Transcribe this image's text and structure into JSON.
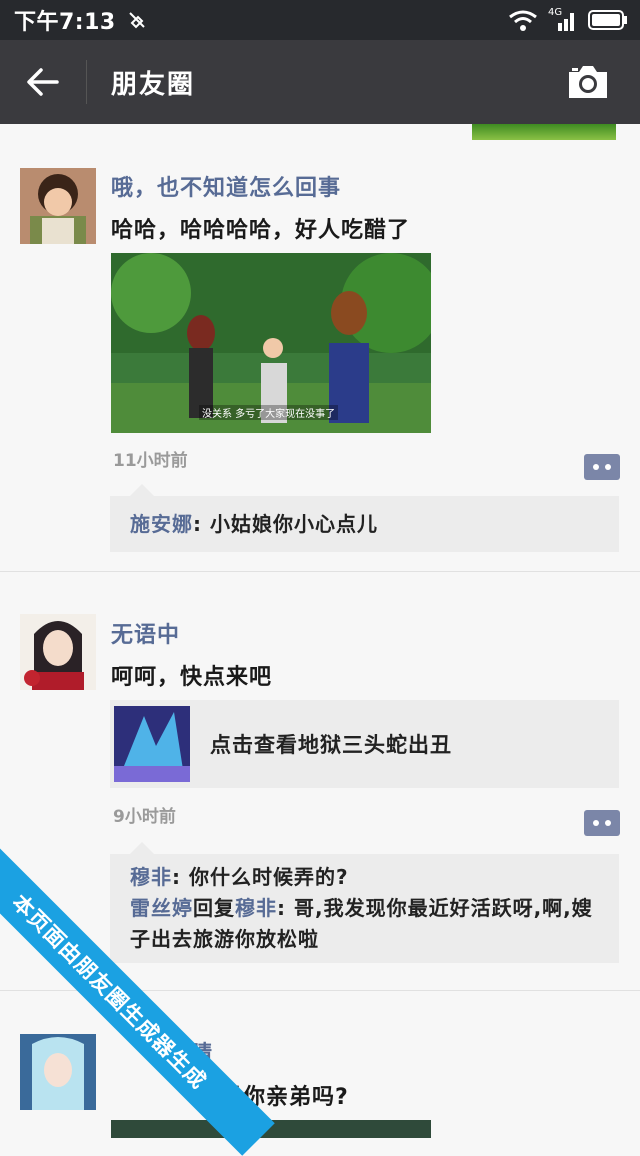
{
  "status_bar": {
    "time": "下午7:13",
    "network": "4G"
  },
  "nav": {
    "title": "朋友圈"
  },
  "posts": [
    {
      "author": "哦，也不知道怎么回事",
      "text": "哈哈，哈哈哈哈，好人吃醋了",
      "photo_caption": "没关系 多亏了大家现在没事了",
      "time": "11小时前",
      "comments": [
        {
          "name": "施安娜",
          "sep": ": ",
          "text": "小姑娘你小心点儿"
        }
      ]
    },
    {
      "author": "无语中",
      "text": "呵呵，快点来吧",
      "link_title": "点击查看地狱三头蛇出丑",
      "time": "9小时前",
      "comments": [
        {
          "name": "穆非",
          "sep": ": ",
          "text": "你什么时候弄的?"
        },
        {
          "name": "雷丝婷",
          "reply_word": "回复",
          "reply_to": "穆非",
          "sep": ": ",
          "text": "哥,我发现你最近好活跃呀,啊,嫂子出去旅游你放松啦"
        }
      ]
    },
    {
      "author_partial": "晴",
      "text_partial": "是你亲弟吗?"
    }
  ],
  "watermark": "本页面由朋友圈生成器生成",
  "icons": {
    "back": "arrow-left-icon",
    "camera": "camera-icon",
    "comment": "comment-dots-icon"
  },
  "colors": {
    "statusbar": "#27292d",
    "navbar": "#3a3a3e",
    "name": "#576b95",
    "ribbon": "#1ba1e2"
  }
}
